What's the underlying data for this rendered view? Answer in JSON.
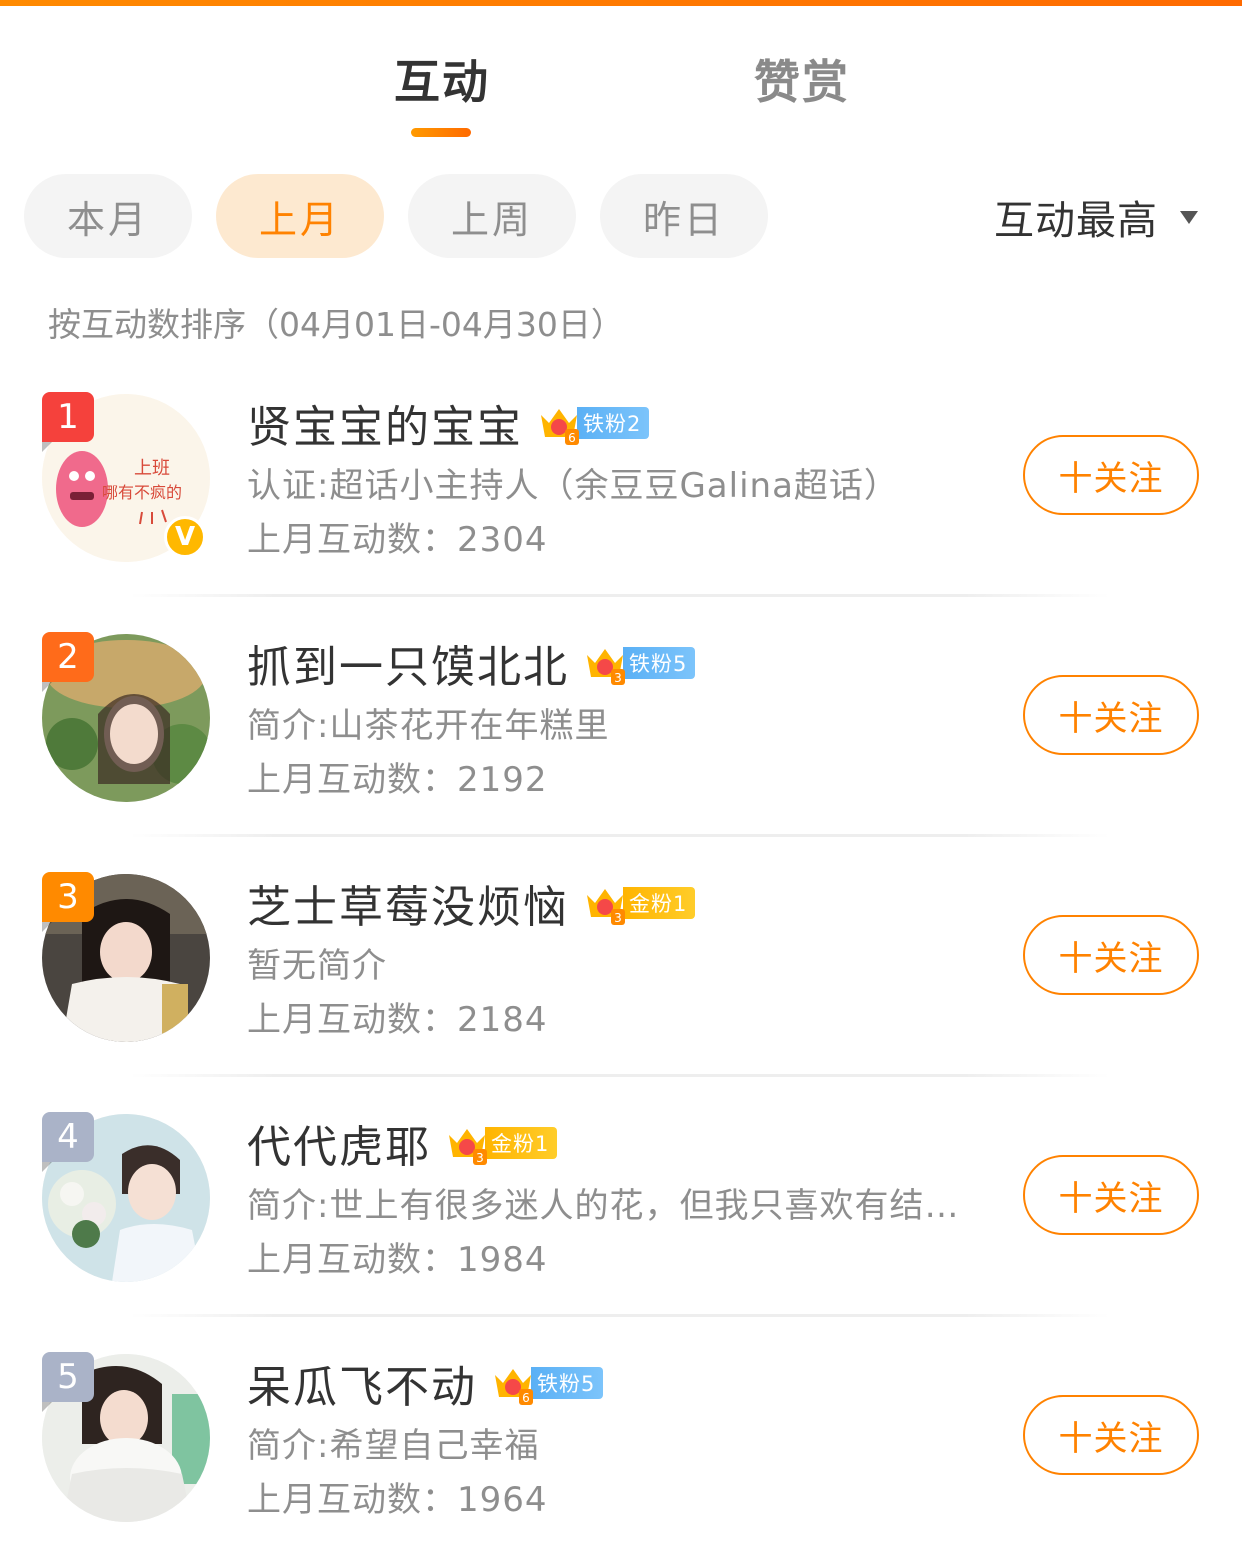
{
  "tabs": {
    "active": "互动",
    "inactive": "赞赏"
  },
  "periods": [
    {
      "label": "本月",
      "selected": false
    },
    {
      "label": "上月",
      "selected": true
    },
    {
      "label": "上周",
      "selected": false
    },
    {
      "label": "昨日",
      "selected": false
    }
  ],
  "sort": {
    "label": "互动最高"
  },
  "subtitle": "按互动数排序（04月01日-04月30日）",
  "colors": {
    "accent": "#ff8200",
    "rank1": "#f5413c",
    "rank2": "#ff6b1a",
    "rank3": "#ff8a00",
    "rank_other": "#aab3c8"
  },
  "follow_label": "十关注",
  "users": [
    {
      "rank": "1",
      "name": "贤宝宝的宝宝",
      "badge": "铁粉2",
      "badge_level": "6",
      "badge_type": "iron",
      "desc": "认证:超话小主持人（余豆豆Galina超话）",
      "count": "上月互动数：2304",
      "verified": true
    },
    {
      "rank": "2",
      "name": "抓到一只馍北北",
      "badge": "铁粉5",
      "badge_level": "3",
      "badge_type": "iron",
      "desc": "简介:山茶花开在年糕里",
      "count": "上月互动数：2192",
      "verified": false
    },
    {
      "rank": "3",
      "name": "芝士草莓没烦恼",
      "badge": "金粉1",
      "badge_level": "3",
      "badge_type": "gold",
      "desc": "暂无简介",
      "count": "上月互动数：2184",
      "verified": false
    },
    {
      "rank": "4",
      "name": "代代虎耶",
      "badge": "金粉1",
      "badge_level": "3",
      "badge_type": "gold",
      "desc": "简介:世上有很多迷人的花，但我只喜欢有结…",
      "count": "上月互动数：1984",
      "verified": false
    },
    {
      "rank": "5",
      "name": "呆瓜飞不动",
      "badge": "铁粉5",
      "badge_level": "6",
      "badge_type": "iron",
      "desc": "简介:希望自己幸福",
      "count": "上月互动数：1964",
      "verified": false
    }
  ],
  "avatar1_text": {
    "line1": "上班",
    "line2": "哪有不疯的"
  },
  "verify_mark": "V"
}
